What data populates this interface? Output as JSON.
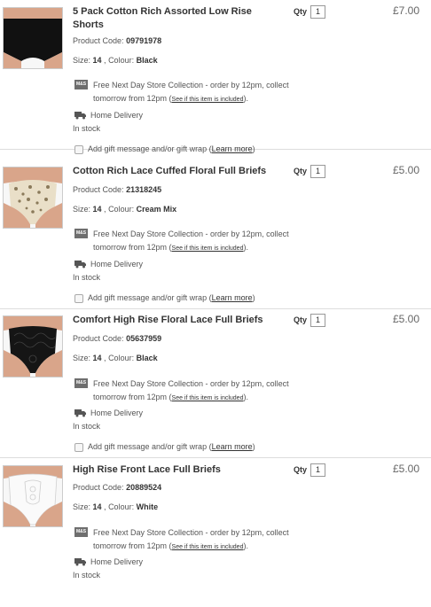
{
  "common": {
    "qty_label": "Qty",
    "product_code_label": "Product Code:",
    "size_label": "Size:",
    "colour_label": "Colour:",
    "store_icon_text": "M&S",
    "collection_line1": "Free Next Day Store Collection - order by 12pm, collect",
    "collection_line2_prefix": "tomorrow from 12pm (",
    "see_link": "See if this item is included",
    "collection_line2_suffix": ").",
    "home_delivery": "Home Delivery",
    "in_stock": "In stock",
    "gift_text": "Add gift message and/or gift wrap (",
    "learn_more": "Learn more",
    "gift_suffix": ")"
  },
  "basket": {
    "items": [
      {
        "title": "5 Pack Cotton Rich Assorted Low Rise Shorts",
        "product_code": "09791978",
        "qty": "1",
        "size": "14",
        "colour": "Black",
        "price": "£7.00"
      },
      {
        "title": "Cotton Rich Lace Cuffed Floral Full Briefs",
        "product_code": "21318245",
        "qty": "1",
        "size": "14",
        "colour": "Cream Mix",
        "price": "£5.00"
      },
      {
        "title": "Comfort High Rise Floral Lace Full Briefs",
        "product_code": "05637959",
        "qty": "1",
        "size": "14",
        "colour": "Black",
        "price": "£5.00"
      },
      {
        "title": "High Rise Front Lace Full Briefs",
        "product_code": "20889524",
        "qty": "1",
        "size": "14",
        "colour": "White",
        "price": "£5.00"
      }
    ]
  },
  "colors": {
    "text": "#333333",
    "muted": "#555555",
    "price": "#666666",
    "divider": "#dddddd"
  }
}
